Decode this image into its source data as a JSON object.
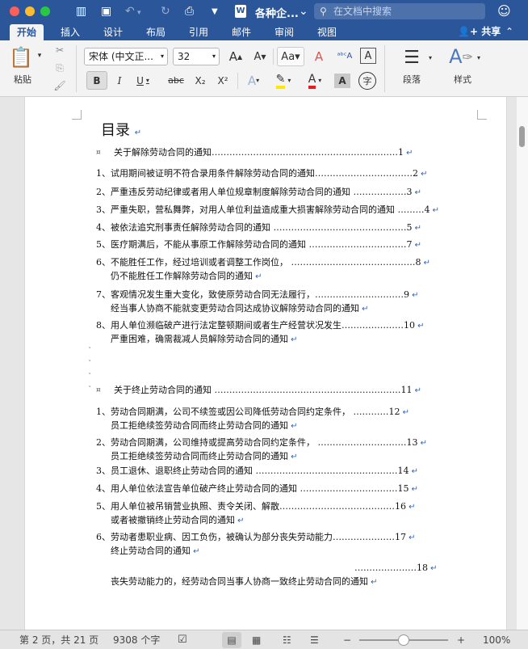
{
  "titlebar": {
    "doc_title": "各种企...",
    "search_placeholder": "在文档中搜索"
  },
  "tabs": [
    "开始",
    "插入",
    "设计",
    "布局",
    "引用",
    "邮件",
    "审阅",
    "视图"
  ],
  "share_label": "共享",
  "ribbon": {
    "paste_label": "粘贴",
    "font_name": "宋体 (中文正...",
    "font_size": "32",
    "paragraph_label": "段落",
    "styles_label": "样式",
    "bold": "B",
    "italic": "I",
    "underline": "U",
    "strike": "abc",
    "sub": "X₂",
    "sup": "X²",
    "grow": "A",
    "shrink": "A",
    "clear": "A",
    "phonetic": "字",
    "char_border": "A",
    "char_shade": "A"
  },
  "colors": {
    "accent": "#2b579a",
    "highlight": "#ffe800",
    "font_color": "#e02020",
    "mark": "#2f62b5"
  },
  "toc": {
    "title": "目录",
    "entries": [
      {
        "lines": [
          "关于解除劳动合同的通知………………………………………………………1"
        ]
      },
      {
        "lines": [
          "1、试用期间被证明不符合录用条件解除劳动合同的通知……………………………2"
        ]
      },
      {
        "lines": [
          "2、严重违反劳动纪律或者用人单位规章制度解除劳动合同的通知 ………………3"
        ]
      },
      {
        "lines": [
          "3、严重失职，营私舞弊，对用人单位利益造成重大损害解除劳动合同的通知   ………4"
        ]
      },
      {
        "lines": [
          "4、被依法追究刑事责任解除劳动合同的通知   ………………………………………5"
        ]
      },
      {
        "lines": [
          "5、医疗期满后，不能从事原工作解除劳动合同的通知  ……………………………7"
        ]
      },
      {
        "lines": [
          "6、不能胜任工作，经过培训或者调整工作岗位，   ……………………………………8",
          "仍不能胜任工作解除劳动合同的通知"
        ]
      },
      {
        "lines": [
          "7、客观情况发生重大变化，致使原劳动合同无法履行，…………………………9",
          "经当事人协商不能就变更劳动合同达成协议解除劳动合同的通知"
        ]
      },
      {
        "lines": [
          "8、用人单位濒临破产进行法定整顿期间或者生产经营状况发生…………………10",
          "严重困难，确需裁减人员解除劳动合同的通知"
        ]
      },
      {
        "lines": [
          "关于终止劳动合同的通知   ………………………………………………………11"
        ]
      },
      {
        "lines": [
          "1、劳动合同期满，公司不续签或因公司降低劳动合同约定条件，   …………12",
          "员工拒绝续签劳动合同而终止劳动合同的通知"
        ]
      },
      {
        "lines": [
          "2、劳动合同期满，公司维持或提高劳动合同约定条件，   …………………………13",
          "员工拒绝续签劳动合同而终止劳动合同的通知"
        ]
      },
      {
        "lines": [
          "3、员工退休、退职终止劳动合同的通知  …………………………………………14"
        ]
      },
      {
        "lines": [
          "4、用人单位依法宣告单位破产终止劳动合同的通知  ……………………………15"
        ]
      },
      {
        "lines": [
          "5、用人单位被吊销营业执照、责令关闭、解散…………………………………16",
          "或者被撤销终止劳动合同的通知"
        ]
      },
      {
        "lines": [
          "6、劳动者患职业病、因工负伤，被确认为部分丧失劳动能力…………………17",
          "终止劳动合同的通知"
        ]
      },
      {
        "lines": [
          "…………………18",
          "丧失劳动能力的，经劳动合同当事人协商一致终止劳动合同的通知"
        ]
      }
    ]
  },
  "status": {
    "page": "第 2 页，共 21 页",
    "words": "9308 个字",
    "zoom": "100%"
  }
}
